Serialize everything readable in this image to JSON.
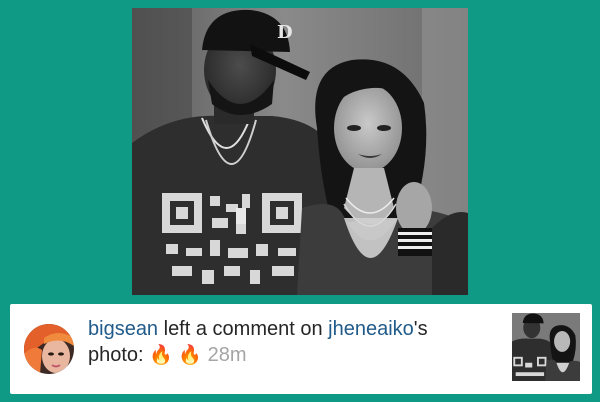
{
  "photo": {
    "description_icon": "black-and-white-couple-photo",
    "cap_letter": "D"
  },
  "notification": {
    "actor": "bigsean",
    "text_middle": " left a comment on ",
    "target": "jheneaiko",
    "possessive": "'s",
    "text_end": "photo: ",
    "emoji_1": "🔥",
    "emoji_2": "🔥",
    "time": "28m"
  },
  "colors": {
    "background": "#0e9a85",
    "link": "#215b8a",
    "time": "#a5a5a5",
    "card": "#ffffff",
    "avatar_hair": "#e4602a"
  }
}
